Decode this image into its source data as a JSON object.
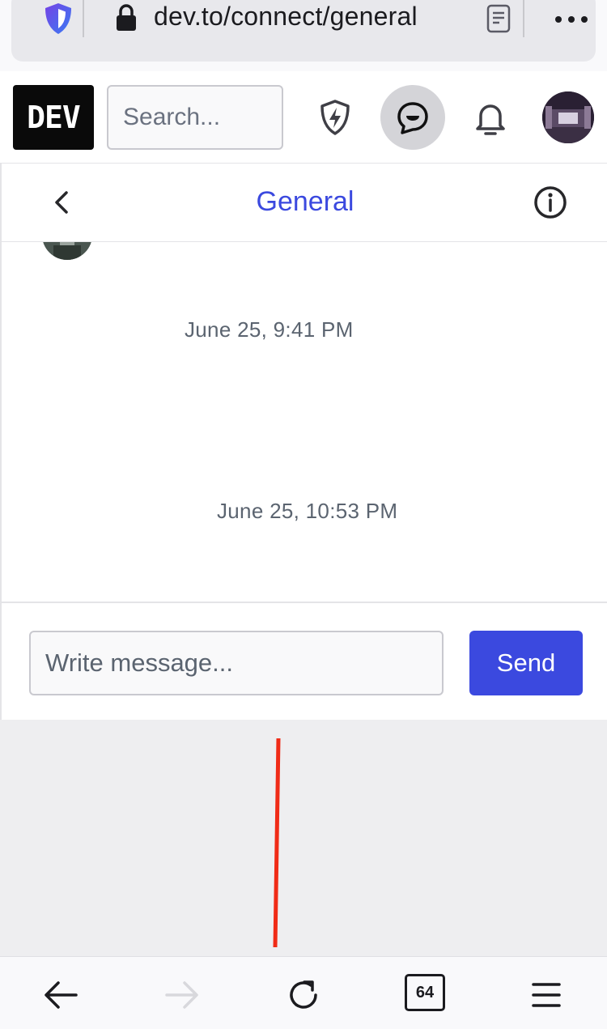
{
  "browser": {
    "url": "dev.to/connect/general",
    "tab_count": "64"
  },
  "header": {
    "logo_text": "DEV",
    "search_placeholder": "Search..."
  },
  "chat": {
    "channel_title": "General",
    "timestamps": [
      "June 25, 9:41 PM",
      "June 25, 10:53 PM"
    ],
    "message_placeholder": "Write message...",
    "send_label": "Send"
  },
  "colors": {
    "accent": "#3b49df",
    "annotation_line": "#f02b17"
  },
  "icons": {
    "url_bar": [
      "shield-icon",
      "lock-icon",
      "reader-mode-icon",
      "more-icon"
    ],
    "header": [
      "lightning-shield-icon",
      "connect-chat-icon",
      "bell-icon"
    ],
    "chat_head": [
      "back-chevron-icon",
      "info-icon"
    ],
    "toolbar": [
      "back-arrow-icon",
      "forward-arrow-icon",
      "reload-icon",
      "menu-icon"
    ]
  }
}
